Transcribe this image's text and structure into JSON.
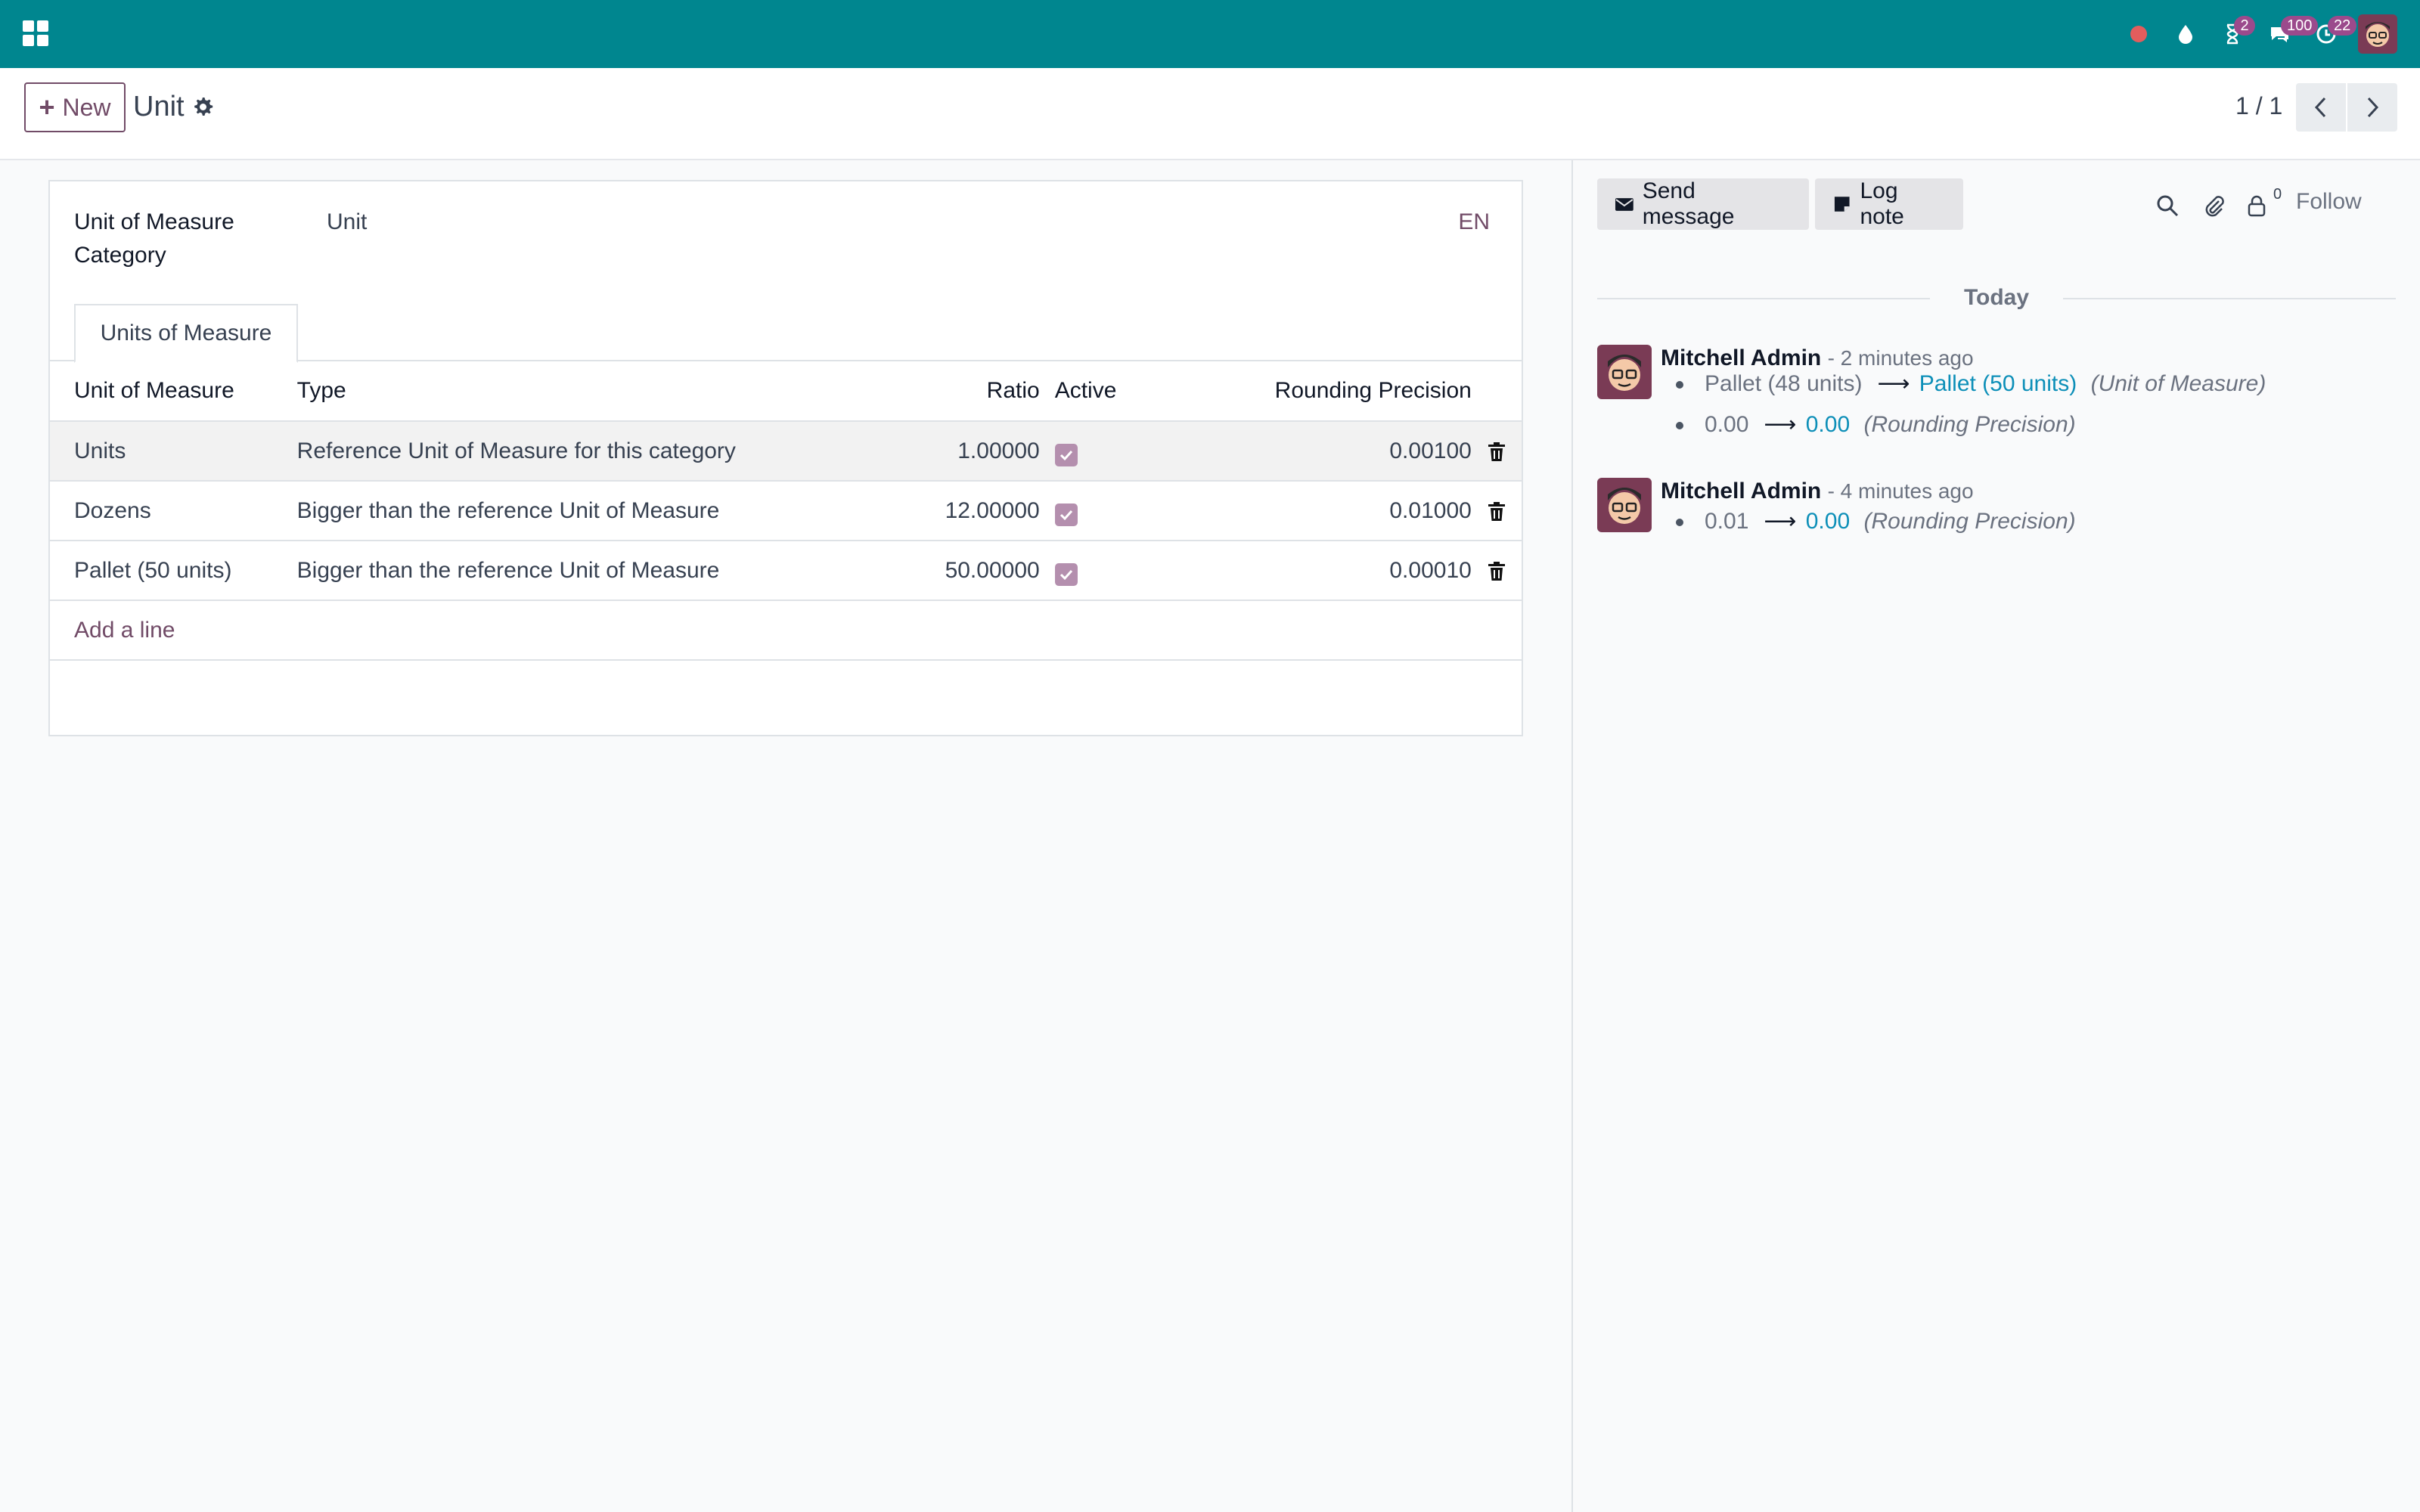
{
  "navbar": {
    "icons": [
      "apps-icon",
      "recording-icon",
      "droplet-icon",
      "hourglass-icon",
      "chat-icon",
      "activity-clock-icon"
    ],
    "badges": {
      "activities": "2",
      "messages": "100",
      "clock": "22"
    },
    "accent": "#00868f"
  },
  "control_panel": {
    "new_label": "New",
    "title": "Unit",
    "pager": "1 / 1"
  },
  "form": {
    "category_label": "Unit of Measure Category",
    "category_value": "Unit",
    "lang": "EN",
    "tab_label": "Units of Measure",
    "columns": [
      "Unit of Measure",
      "Type",
      "Ratio",
      "Active",
      "Rounding Precision"
    ],
    "rows": [
      {
        "uom": "Units",
        "type": "Reference Unit of Measure for this category",
        "ratio": "1.00000",
        "active": true,
        "rounding": "0.00100"
      },
      {
        "uom": "Dozens",
        "type": "Bigger than the reference Unit of Measure",
        "ratio": "12.00000",
        "active": true,
        "rounding": "0.01000"
      },
      {
        "uom": "Pallet (50 units)",
        "type": "Bigger than the reference Unit of Measure",
        "ratio": "50.00000",
        "active": true,
        "rounding": "0.00010"
      }
    ],
    "add_line": "Add a line"
  },
  "chatter": {
    "send_message": "Send message",
    "log_note": "Log note",
    "followers_count": "0",
    "follow": "Follow",
    "date_separator": "Today",
    "messages": [
      {
        "author": "Mitchell Admin",
        "date": "- 2 minutes ago",
        "tracking": [
          {
            "old": "Pallet (48 units)",
            "new": "Pallet (50 units)",
            "field": "(Unit of Measure)"
          },
          {
            "old": "0.00",
            "new": "0.00",
            "field": "(Rounding Precision)"
          }
        ]
      },
      {
        "author": "Mitchell Admin",
        "date": "- 4 minutes ago",
        "tracking": [
          {
            "old": "0.01",
            "new": "0.00",
            "field": "(Rounding Precision)"
          }
        ]
      }
    ]
  }
}
